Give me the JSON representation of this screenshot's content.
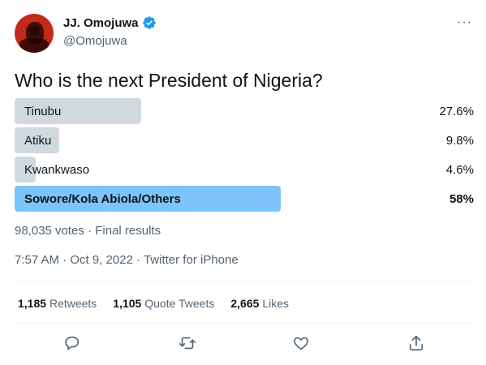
{
  "tweet": {
    "author_name": "JJ. Omojuwa",
    "handle": "@Omojuwa",
    "more_label": "···",
    "question": "Who is the next President of Nigeria?",
    "poll": [
      {
        "label": "Tinubu",
        "percent_text": "27.6%",
        "percent": 27.6,
        "winner": false
      },
      {
        "label": "Atiku",
        "percent_text": "9.8%",
        "percent": 9.8,
        "winner": false
      },
      {
        "label": "Kwankwaso",
        "percent_text": "4.6%",
        "percent": 4.6,
        "winner": false
      },
      {
        "label": "Sowore/Kola Abiola/Others",
        "percent_text": "58%",
        "percent": 58,
        "winner": true
      }
    ],
    "poll_results": "98,035 votes · Final results",
    "timestamp_line": "7:57 AM · Oct 9, 2022 · Twitter for iPhone",
    "stats": {
      "retweets_count": "1,185",
      "retweets_label": "Retweets",
      "quotes_count": "1,105",
      "quotes_label": "Quote Tweets",
      "likes_count": "2,665",
      "likes_label": "Likes"
    },
    "actions": [
      "reply-icon",
      "retweet-icon",
      "like-icon",
      "share-icon"
    ],
    "colors": {
      "poll_bar": "#cfd9de",
      "poll_bar_winner": "#7cc4fa",
      "verified": "#1d9bf0",
      "muted_text": "#536471"
    }
  }
}
